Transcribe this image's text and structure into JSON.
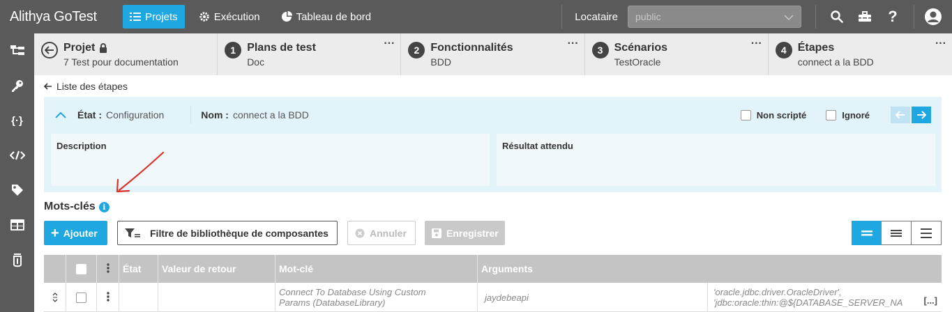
{
  "app": {
    "title": "Alithya GoTest"
  },
  "topnav": {
    "items": [
      {
        "label": "Projets",
        "icon": "list-icon",
        "active": true
      },
      {
        "label": "Exécution",
        "icon": "gear-icon",
        "active": false
      },
      {
        "label": "Tableau de bord",
        "icon": "pie-chart-icon",
        "active": false
      }
    ],
    "tenant_label": "Locataire",
    "tenant_value": "public",
    "icons": [
      "search-icon",
      "toolbox-icon",
      "help-icon",
      "user-icon"
    ]
  },
  "sidebar": {
    "icons": [
      "hierarchy-icon",
      "key-icon",
      "braces-icon",
      "code-icon",
      "tag-icon",
      "table-icon",
      "bulb-icon"
    ]
  },
  "breadcrumb": [
    {
      "number": "",
      "title": "Projet",
      "subtitle": "7 Test pour documentation",
      "locked": true
    },
    {
      "number": "1",
      "title": "Plans de test",
      "subtitle": "Doc"
    },
    {
      "number": "2",
      "title": "Fonctionnalités",
      "subtitle": "BDD"
    },
    {
      "number": "3",
      "title": "Scénarios",
      "subtitle": "TestOracle"
    },
    {
      "number": "4",
      "title": "Étapes",
      "subtitle": "connect a la BDD"
    }
  ],
  "back_link": "Liste des étapes",
  "step": {
    "state_label": "État :",
    "state_value": "Configuration",
    "name_label": "Nom :",
    "name_value": "connect a la BDD",
    "not_scripted_label": "Non scripté",
    "ignored_label": "Ignoré",
    "description_label": "Description",
    "expected_label": "Résultat attendu"
  },
  "keywords": {
    "title": "Mots-clés",
    "add_label": "Ajouter",
    "filter_label": "Filtre de bibliothèque de composantes",
    "cancel_label": "Annuler",
    "save_label": "Enregistrer"
  },
  "table": {
    "headers": [
      "",
      "",
      "",
      "État",
      "Valeur de retour",
      "Mot-clé",
      "Arguments",
      ""
    ],
    "rows": [
      {
        "state": "",
        "return_value": "",
        "keyword_line1": "Connect To Database Using Custom",
        "keyword_line2": "Params (DatabaseLibrary)",
        "arg1": "jaydebeapi",
        "arg2_line1": "'oracle.jdbc.driver.OracleDriver',",
        "arg2_line2": "'jdbc:oracle:thin:@${DATABASE_SERVER_NA",
        "more": "[...]"
      }
    ]
  },
  "colors": {
    "primary": "#1ea7e1",
    "topbar": "#5a5a5a",
    "panel": "#e3f3fa",
    "annotation": "#d9322a"
  }
}
